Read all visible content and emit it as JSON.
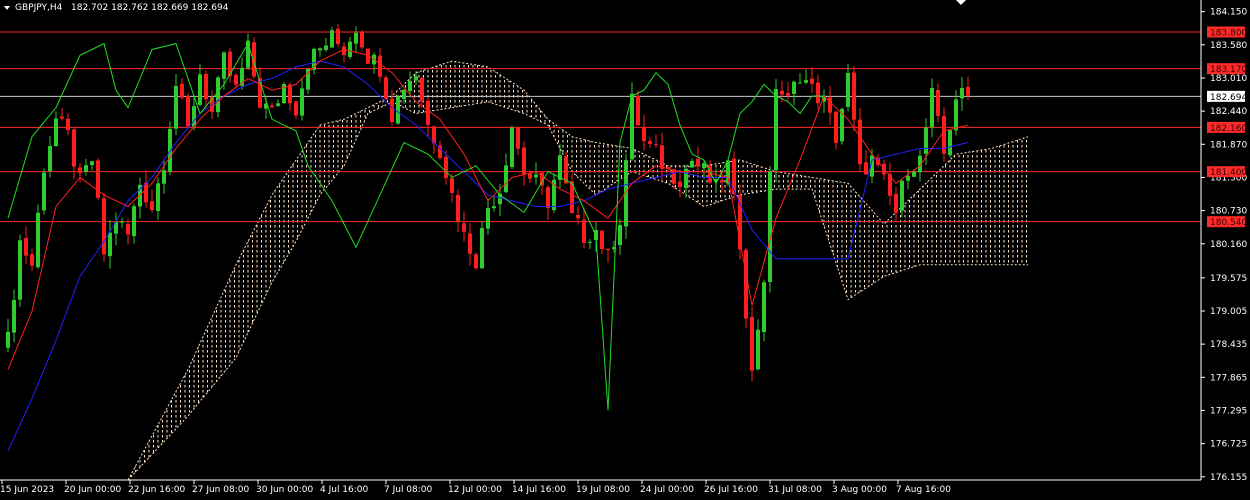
{
  "header": {
    "symbol": "GBPJPY,H4",
    "ohlc": "182.702 182.762 182.669 182.694"
  },
  "colors": {
    "background": "#000000",
    "bull": "#2ecc2e",
    "bear": "#ff1e1e",
    "level_line": "#ff2a2a",
    "price_line": "#c8c8c8",
    "tenkan": "#ff2020",
    "kijun": "#2020ff",
    "chikou": "#22dd22",
    "cloud": "#ffe4c4",
    "axis": "#ffffff"
  },
  "chart_data": {
    "type": "candlestick",
    "instrument": "GBPJPY",
    "timeframe": "H4",
    "ylim": [
      176.1,
      184.35
    ],
    "y_ticks": [
      "184.150",
      "183.580",
      "183.010",
      "182.440",
      "181.870",
      "181.300",
      "180.730",
      "180.160",
      "179.575",
      "179.005",
      "178.435",
      "177.865",
      "177.295",
      "176.725",
      "176.155"
    ],
    "x_ticks": [
      "15 Jun 2023",
      "20 Jun 00:00",
      "22 Jun 16:00",
      "27 Jun 08:00",
      "30 Jun 00:00",
      "4 Jul 16:00",
      "7 Jul 08:00",
      "12 Jul 00:00",
      "14 Jul 16:00",
      "19 Jul 08:00",
      "24 Jul 00:00",
      "26 Jul 16:00",
      "31 Jul 08:00",
      "3 Aug 00:00",
      "7 Aug 16:00"
    ],
    "current_price": "182.694",
    "levels": [
      {
        "value": 183.8,
        "label": "183.800"
      },
      {
        "value": 183.17,
        "label": "183.170"
      },
      {
        "value": 182.16,
        "label": "182.160"
      },
      {
        "value": 181.4,
        "label": "181.400"
      },
      {
        "value": 180.54,
        "label": "180.540"
      }
    ],
    "close_path": [
      [
        0,
        178.5
      ],
      [
        2,
        180.2
      ],
      [
        4,
        179.8
      ],
      [
        6,
        181.5
      ],
      [
        8,
        182.3
      ],
      [
        10,
        182.0
      ],
      [
        12,
        181.2
      ],
      [
        14,
        181.6
      ],
      [
        16,
        180.0
      ],
      [
        18,
        180.6
      ],
      [
        20,
        180.3
      ],
      [
        22,
        181.2
      ],
      [
        24,
        180.8
      ],
      [
        26,
        181.6
      ],
      [
        28,
        182.9
      ],
      [
        30,
        182.1
      ],
      [
        32,
        183.1
      ],
      [
        34,
        182.4
      ],
      [
        36,
        183.3
      ],
      [
        38,
        182.8
      ],
      [
        40,
        183.5
      ],
      [
        42,
        182.6
      ],
      [
        44,
        182.4
      ],
      [
        46,
        182.9
      ],
      [
        48,
        182.5
      ],
      [
        50,
        183.3
      ],
      [
        52,
        183.5
      ],
      [
        54,
        183.7
      ],
      [
        56,
        183.5
      ],
      [
        58,
        183.9
      ],
      [
        60,
        183.4
      ],
      [
        62,
        183.2
      ],
      [
        64,
        182.4
      ],
      [
        66,
        182.9
      ],
      [
        68,
        183.1
      ],
      [
        70,
        182.2
      ],
      [
        72,
        181.8
      ],
      [
        74,
        181.0
      ],
      [
        76,
        180.3
      ],
      [
        78,
        179.9
      ],
      [
        80,
        180.8
      ],
      [
        82,
        181.1
      ],
      [
        84,
        182.2
      ],
      [
        86,
        181.4
      ],
      [
        88,
        181.2
      ],
      [
        90,
        180.9
      ],
      [
        92,
        181.6
      ],
      [
        94,
        180.6
      ],
      [
        96,
        180.3
      ],
      [
        98,
        180.4
      ],
      [
        100,
        179.9
      ],
      [
        102,
        180.6
      ],
      [
        104,
        182.6
      ],
      [
        106,
        181.9
      ],
      [
        108,
        181.7
      ],
      [
        110,
        181.4
      ],
      [
        112,
        181.3
      ],
      [
        114,
        181.6
      ],
      [
        116,
        181.4
      ],
      [
        118,
        181.1
      ],
      [
        120,
        181.5
      ],
      [
        122,
        180.2
      ],
      [
        124,
        177.9
      ],
      [
        126,
        179.6
      ],
      [
        128,
        182.9
      ],
      [
        130,
        182.6
      ],
      [
        132,
        183.1
      ],
      [
        134,
        182.8
      ],
      [
        136,
        182.6
      ],
      [
        138,
        182.0
      ],
      [
        140,
        183.0
      ],
      [
        142,
        181.4
      ],
      [
        144,
        181.6
      ],
      [
        146,
        181.2
      ],
      [
        148,
        180.7
      ],
      [
        150,
        181.5
      ],
      [
        152,
        181.6
      ],
      [
        154,
        182.7
      ],
      [
        156,
        181.7
      ],
      [
        158,
        182.7
      ],
      [
        160,
        182.69
      ]
    ],
    "tenkan_path": [
      [
        0,
        178.0
      ],
      [
        4,
        179.0
      ],
      [
        8,
        180.8
      ],
      [
        12,
        181.3
      ],
      [
        16,
        181.0
      ],
      [
        20,
        180.8
      ],
      [
        24,
        181.2
      ],
      [
        28,
        181.8
      ],
      [
        32,
        182.3
      ],
      [
        36,
        182.7
      ],
      [
        40,
        183.0
      ],
      [
        44,
        182.8
      ],
      [
        48,
        182.9
      ],
      [
        52,
        183.3
      ],
      [
        56,
        183.5
      ],
      [
        60,
        183.4
      ],
      [
        64,
        183.1
      ],
      [
        68,
        182.6
      ],
      [
        72,
        182.3
      ],
      [
        76,
        181.7
      ],
      [
        80,
        180.9
      ],
      [
        84,
        181.3
      ],
      [
        88,
        181.4
      ],
      [
        92,
        181.1
      ],
      [
        96,
        180.9
      ],
      [
        100,
        180.6
      ],
      [
        104,
        181.2
      ],
      [
        108,
        181.5
      ],
      [
        112,
        181.4
      ],
      [
        116,
        181.4
      ],
      [
        120,
        181.3
      ],
      [
        124,
        179.1
      ],
      [
        128,
        180.6
      ],
      [
        132,
        181.6
      ],
      [
        136,
        182.7
      ],
      [
        140,
        182.3
      ],
      [
        144,
        181.7
      ],
      [
        148,
        181.2
      ],
      [
        152,
        181.5
      ],
      [
        156,
        182.1
      ],
      [
        160,
        182.2
      ]
    ],
    "kijun_path": [
      [
        0,
        176.6
      ],
      [
        4,
        177.5
      ],
      [
        8,
        178.5
      ],
      [
        12,
        179.6
      ],
      [
        16,
        180.2
      ],
      [
        20,
        180.9
      ],
      [
        24,
        181.3
      ],
      [
        28,
        181.9
      ],
      [
        32,
        182.4
      ],
      [
        36,
        182.7
      ],
      [
        40,
        182.9
      ],
      [
        44,
        183.0
      ],
      [
        48,
        183.2
      ],
      [
        52,
        183.3
      ],
      [
        56,
        183.2
      ],
      [
        60,
        182.9
      ],
      [
        64,
        182.5
      ],
      [
        68,
        182.2
      ],
      [
        72,
        181.8
      ],
      [
        76,
        181.4
      ],
      [
        80,
        181.0
      ],
      [
        84,
        180.9
      ],
      [
        88,
        180.8
      ],
      [
        92,
        180.8
      ],
      [
        96,
        180.9
      ],
      [
        100,
        181.1
      ],
      [
        104,
        181.2
      ],
      [
        108,
        181.3
      ],
      [
        112,
        181.4
      ],
      [
        116,
        181.3
      ],
      [
        120,
        181.3
      ],
      [
        124,
        180.4
      ],
      [
        128,
        179.9
      ],
      [
        132,
        179.9
      ],
      [
        136,
        179.9
      ],
      [
        140,
        179.9
      ],
      [
        144,
        181.6
      ],
      [
        148,
        181.7
      ],
      [
        152,
        181.8
      ],
      [
        156,
        181.8
      ],
      [
        160,
        181.9
      ]
    ],
    "chikou_path": [
      [
        0,
        180.6
      ],
      [
        4,
        182.0
      ],
      [
        8,
        182.5
      ],
      [
        12,
        183.4
      ],
      [
        16,
        183.6
      ],
      [
        18,
        182.8
      ],
      [
        20,
        182.5
      ],
      [
        24,
        183.5
      ],
      [
        28,
        183.6
      ],
      [
        32,
        182.4
      ],
      [
        36,
        182.9
      ],
      [
        40,
        183.6
      ],
      [
        44,
        182.3
      ],
      [
        48,
        182.1
      ],
      [
        50,
        181.5
      ],
      [
        54,
        180.9
      ],
      [
        58,
        180.1
      ],
      [
        62,
        181.0
      ],
      [
        66,
        181.9
      ],
      [
        70,
        181.7
      ],
      [
        74,
        181.3
      ],
      [
        78,
        181.5
      ],
      [
        82,
        181.0
      ],
      [
        86,
        180.7
      ],
      [
        90,
        181.4
      ],
      [
        94,
        181.2
      ],
      [
        98,
        180.3
      ],
      [
        100,
        177.3
      ],
      [
        102,
        181.9
      ],
      [
        104,
        182.7
      ],
      [
        106,
        182.8
      ],
      [
        108,
        183.1
      ],
      [
        110,
        182.9
      ],
      [
        112,
        182.2
      ],
      [
        114,
        181.7
      ],
      [
        116,
        181.6
      ],
      [
        118,
        181.2
      ],
      [
        120,
        181.6
      ],
      [
        122,
        182.4
      ],
      [
        124,
        182.6
      ],
      [
        126,
        182.9
      ],
      [
        128,
        182.7
      ],
      [
        130,
        182.6
      ],
      [
        132,
        182.4
      ],
      [
        134,
        182.7
      ],
      [
        136,
        182.7
      ]
    ],
    "cloud": {
      "top": [
        [
          20,
          176.1
        ],
        [
          30,
          178.0
        ],
        [
          38,
          179.8
        ],
        [
          44,
          181.0
        ],
        [
          48,
          181.6
        ],
        [
          52,
          182.2
        ],
        [
          56,
          182.3
        ],
        [
          60,
          182.5
        ],
        [
          64,
          182.7
        ],
        [
          68,
          183.1
        ],
        [
          74,
          183.3
        ],
        [
          80,
          183.2
        ],
        [
          86,
          182.8
        ],
        [
          90,
          182.3
        ],
        [
          94,
          182.0
        ],
        [
          98,
          181.9
        ],
        [
          104,
          181.8
        ],
        [
          110,
          181.5
        ],
        [
          116,
          181.5
        ],
        [
          122,
          181.6
        ],
        [
          128,
          181.4
        ],
        [
          134,
          181.3
        ],
        [
          140,
          181.2
        ],
        [
          146,
          180.5
        ],
        [
          152,
          181.1
        ],
        [
          158,
          181.7
        ],
        [
          164,
          181.8
        ],
        [
          170,
          182.0
        ]
      ],
      "bottom": [
        [
          20,
          176.1
        ],
        [
          30,
          177.2
        ],
        [
          38,
          178.2
        ],
        [
          44,
          179.5
        ],
        [
          48,
          180.2
        ],
        [
          52,
          181.0
        ],
        [
          56,
          181.5
        ],
        [
          60,
          182.4
        ],
        [
          64,
          182.6
        ],
        [
          68,
          182.4
        ],
        [
          74,
          182.5
        ],
        [
          80,
          182.6
        ],
        [
          86,
          182.4
        ],
        [
          90,
          182.2
        ],
        [
          94,
          181.4
        ],
        [
          98,
          181.0
        ],
        [
          104,
          181.4
        ],
        [
          110,
          181.2
        ],
        [
          116,
          180.8
        ],
        [
          122,
          181.0
        ],
        [
          128,
          181.1
        ],
        [
          134,
          181.1
        ],
        [
          140,
          179.2
        ],
        [
          146,
          179.6
        ],
        [
          152,
          179.8
        ],
        [
          158,
          179.8
        ],
        [
          164,
          179.8
        ],
        [
          170,
          179.8
        ]
      ]
    }
  }
}
